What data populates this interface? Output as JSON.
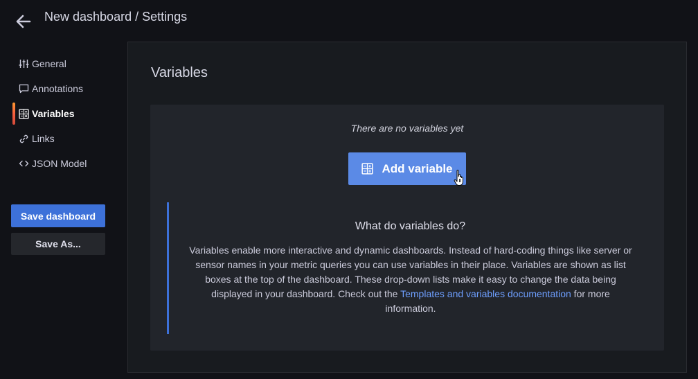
{
  "header": {
    "title": "New dashboard / Settings",
    "back_icon": "arrow-left-icon"
  },
  "sidebar": {
    "items": [
      {
        "label": "General",
        "icon": "sliders-icon",
        "active": false
      },
      {
        "label": "Annotations",
        "icon": "comment-icon",
        "active": false
      },
      {
        "label": "Variables",
        "icon": "calculator-icon",
        "active": true
      },
      {
        "label": "Links",
        "icon": "link-icon",
        "active": false
      },
      {
        "label": "JSON Model",
        "icon": "code-icon",
        "active": false
      }
    ],
    "save_label": "Save dashboard",
    "save_as_label": "Save As..."
  },
  "main": {
    "title": "Variables",
    "empty_message": "There are no variables yet",
    "add_button_label": "Add variable",
    "info": {
      "title": "What do variables do?",
      "text_before_link": "Variables enable more interactive and dynamic dashboards. Instead of hard-coding things like server or sensor names in your metric queries you can use variables in their place. Variables are shown as list boxes at the top of the dashboard. These drop-down lists make it easy to change the data being displayed in your dashboard. Check out the ",
      "link_text": "Templates and variables documentation",
      "text_after_link": " for more information."
    }
  },
  "colors": {
    "background": "#111217",
    "panel": "#181b1f",
    "card": "#22252b",
    "primary": "#3d71d9",
    "add_button": "#5b8ae6",
    "link": "#6e9fff",
    "active_accent": "#f55f3e"
  }
}
